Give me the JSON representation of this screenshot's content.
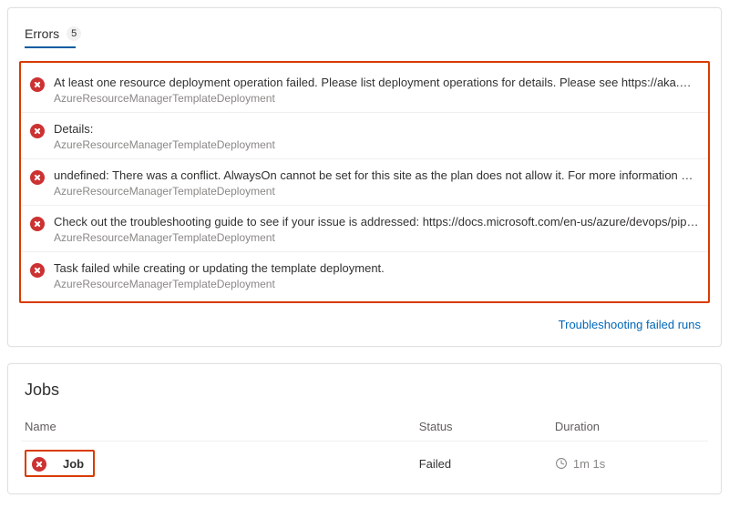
{
  "errors_panel": {
    "tab_label": "Errors",
    "count": "5",
    "troubleshoot_link": "Troubleshooting failed runs",
    "items": [
      {
        "message": "At least one resource deployment operation failed. Please list deployment operations for details. Please see https://aka.ms/DeployOper…",
        "source": "AzureResourceManagerTemplateDeployment"
      },
      {
        "message": "Details:",
        "source": "AzureResourceManagerTemplateDeployment"
      },
      {
        "message": "undefined: There was a conflict. AlwaysOn cannot be set for this site as the plan does not allow it. For more information on pricing and f…",
        "source": "AzureResourceManagerTemplateDeployment"
      },
      {
        "message": "Check out the troubleshooting guide to see if your issue is addressed: https://docs.microsoft.com/en-us/azure/devops/pipelines/tasks/…",
        "source": "AzureResourceManagerTemplateDeployment"
      },
      {
        "message": "Task failed while creating or updating the template deployment.",
        "source": "AzureResourceManagerTemplateDeployment"
      }
    ]
  },
  "jobs_panel": {
    "title": "Jobs",
    "columns": {
      "name": "Name",
      "status": "Status",
      "duration": "Duration"
    },
    "rows": [
      {
        "name": "Job",
        "status": "Failed",
        "duration": "1m 1s"
      }
    ]
  }
}
